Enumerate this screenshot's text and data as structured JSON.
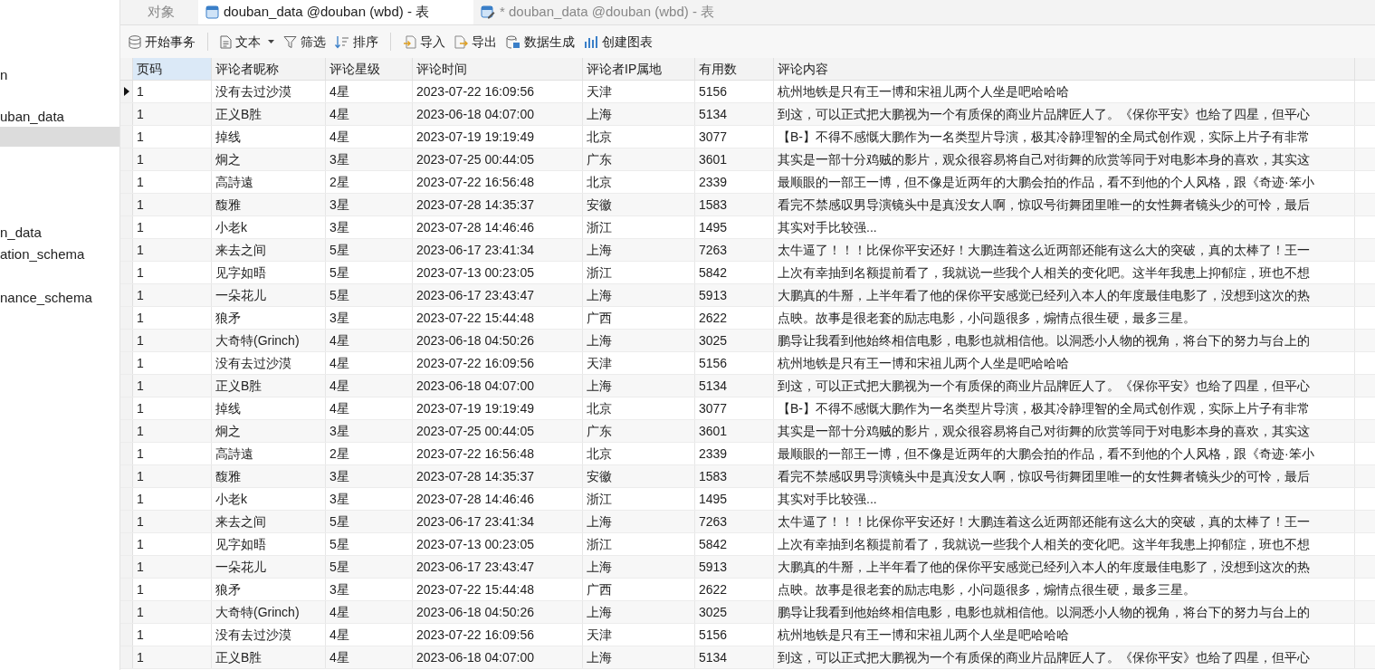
{
  "sidebar": {
    "items": [
      {
        "label": "n",
        "selected": false
      },
      {
        "label": "uban_data",
        "selected": false
      },
      {
        "selected": true
      },
      {
        "label": "n_data",
        "selected": false
      },
      {
        "label": "ation_schema",
        "selected": false
      },
      {
        "label": "nance_schema",
        "selected": false
      }
    ]
  },
  "tabs": [
    {
      "label": "对象",
      "kind": "plain",
      "selected": false
    },
    {
      "label": "douban_data @douban (wbd) - 表",
      "kind": "table",
      "selected": true
    },
    {
      "label": "* douban_data @douban (wbd) - 表",
      "kind": "edit",
      "selected": false
    }
  ],
  "toolbar": [
    {
      "label": "开始事务",
      "kind": "database"
    },
    {
      "label": "文本",
      "kind": "text"
    },
    {
      "label": "筛选",
      "kind": "filter"
    },
    {
      "label": "排序",
      "kind": "sort"
    },
    {
      "label": "导入",
      "kind": "import"
    },
    {
      "label": "导出",
      "kind": "export"
    },
    {
      "label": "数据生成",
      "kind": "generate"
    },
    {
      "label": "创建图表",
      "kind": "chart"
    }
  ],
  "table": {
    "columns": [
      {
        "label": "页码",
        "selected": true
      },
      {
        "label": "评论者昵称",
        "selected": false
      },
      {
        "label": "评论星级",
        "selected": false
      },
      {
        "label": "评论时间",
        "selected": false
      },
      {
        "label": "评论者IP属地",
        "selected": false
      },
      {
        "label": "有用数",
        "selected": false
      },
      {
        "label": "评论内容",
        "selected": false
      }
    ],
    "rows": [
      {
        "selected": true,
        "cells": [
          "1",
          "没有去过沙漠",
          "4星",
          "2023-07-22 16:09:56",
          "天津",
          "5156",
          "杭州地铁是只有王一博和宋祖儿两个人坐是吧哈哈哈"
        ]
      },
      {
        "selected": false,
        "cells": [
          "1",
          "正义B胜",
          "4星",
          "2023-06-18 04:07:00",
          "上海",
          "5134",
          "到这，可以正式把大鹏视为一个有质保的商业片品牌匠人了。《保你平安》也给了四星，但平心"
        ]
      },
      {
        "selected": false,
        "cells": [
          "1",
          "掉线",
          "4星",
          "2023-07-19 19:19:49",
          "北京",
          "3077",
          "【B-】不得不感慨大鹏作为一名类型片导演，极其冷静理智的全局式创作观，实际上片子有非常"
        ]
      },
      {
        "selected": false,
        "cells": [
          "1",
          "炯之",
          "3星",
          "2023-07-25 00:44:05",
          "广东",
          "3601",
          "其实是一部十分鸡贼的影片，观众很容易将自己对街舞的欣赏等同于对电影本身的喜欢，其实这"
        ]
      },
      {
        "selected": false,
        "cells": [
          "1",
          "高詩遠",
          "2星",
          "2023-07-22 16:56:48",
          "北京",
          "2339",
          "最顺眼的一部王一博，但不像是近两年的大鹏会拍的作品，看不到他的个人风格，跟《奇迹·笨小"
        ]
      },
      {
        "selected": false,
        "cells": [
          "1",
          "馥雅",
          "3星",
          "2023-07-28 14:35:37",
          "安徽",
          "1583",
          "看完不禁感叹男导演镜头中是真没女人啊，惊叹号街舞团里唯一的女性舞者镜头少的可怜，最后"
        ]
      },
      {
        "selected": false,
        "cells": [
          "1",
          "小老k",
          "3星",
          "2023-07-28 14:46:46",
          "浙江",
          "1495",
          "其实对手比较强..."
        ]
      },
      {
        "selected": false,
        "cells": [
          "1",
          "来去之间",
          "5星",
          "2023-06-17 23:41:34",
          "上海",
          "7263",
          "太牛逼了！！！比保你平安还好！大鹏连着这么近两部还能有这么大的突破，真的太棒了！王一"
        ]
      },
      {
        "selected": false,
        "cells": [
          "1",
          "见字如晤",
          "5星",
          "2023-07-13 00:23:05",
          "浙江",
          "5842",
          "上次有幸抽到名额提前看了，我就说一些我个人相关的变化吧。这半年我患上抑郁症，班也不想"
        ]
      },
      {
        "selected": false,
        "cells": [
          "1",
          "一朵花儿",
          "5星",
          "2023-06-17 23:43:47",
          "上海",
          "5913",
          "大鹏真的牛掰，上半年看了他的保你平安感觉已经列入本人的年度最佳电影了，没想到这次的热"
        ]
      },
      {
        "selected": false,
        "cells": [
          "1",
          "狼矛",
          "3星",
          "2023-07-22 15:44:48",
          "广西",
          "2622",
          "点映。故事是很老套的励志电影，小问题很多，煽情点很生硬，最多三星。"
        ]
      },
      {
        "selected": false,
        "cells": [
          "1",
          "大奇特(Grinch)",
          "4星",
          "2023-06-18 04:50:26",
          "上海",
          "3025",
          "鹏导让我看到他始终相信电影，电影也就相信他。以洞悉小人物的视角，将台下的努力与台上的"
        ]
      },
      {
        "selected": false,
        "cells": [
          "1",
          "没有去过沙漠",
          "4星",
          "2023-07-22 16:09:56",
          "天津",
          "5156",
          "杭州地铁是只有王一博和宋祖儿两个人坐是吧哈哈哈"
        ]
      },
      {
        "selected": false,
        "cells": [
          "1",
          "正义B胜",
          "4星",
          "2023-06-18 04:07:00",
          "上海",
          "5134",
          "到这，可以正式把大鹏视为一个有质保的商业片品牌匠人了。《保你平安》也给了四星，但平心"
        ]
      },
      {
        "selected": false,
        "cells": [
          "1",
          "掉线",
          "4星",
          "2023-07-19 19:19:49",
          "北京",
          "3077",
          "【B-】不得不感慨大鹏作为一名类型片导演，极其冷静理智的全局式创作观，实际上片子有非常"
        ]
      },
      {
        "selected": false,
        "cells": [
          "1",
          "炯之",
          "3星",
          "2023-07-25 00:44:05",
          "广东",
          "3601",
          "其实是一部十分鸡贼的影片，观众很容易将自己对街舞的欣赏等同于对电影本身的喜欢，其实这"
        ]
      },
      {
        "selected": false,
        "cells": [
          "1",
          "高詩遠",
          "2星",
          "2023-07-22 16:56:48",
          "北京",
          "2339",
          "最顺眼的一部王一博，但不像是近两年的大鹏会拍的作品，看不到他的个人风格，跟《奇迹·笨小"
        ]
      },
      {
        "selected": false,
        "cells": [
          "1",
          "馥雅",
          "3星",
          "2023-07-28 14:35:37",
          "安徽",
          "1583",
          "看完不禁感叹男导演镜头中是真没女人啊，惊叹号街舞团里唯一的女性舞者镜头少的可怜，最后"
        ]
      },
      {
        "selected": false,
        "cells": [
          "1",
          "小老k",
          "3星",
          "2023-07-28 14:46:46",
          "浙江",
          "1495",
          "其实对手比较强..."
        ]
      },
      {
        "selected": false,
        "cells": [
          "1",
          "来去之间",
          "5星",
          "2023-06-17 23:41:34",
          "上海",
          "7263",
          "太牛逼了！！！比保你平安还好！大鹏连着这么近两部还能有这么大的突破，真的太棒了！王一"
        ]
      },
      {
        "selected": false,
        "cells": [
          "1",
          "见字如晤",
          "5星",
          "2023-07-13 00:23:05",
          "浙江",
          "5842",
          "上次有幸抽到名额提前看了，我就说一些我个人相关的变化吧。这半年我患上抑郁症，班也不想"
        ]
      },
      {
        "selected": false,
        "cells": [
          "1",
          "一朵花儿",
          "5星",
          "2023-06-17 23:43:47",
          "上海",
          "5913",
          "大鹏真的牛掰，上半年看了他的保你平安感觉已经列入本人的年度最佳电影了，没想到这次的热"
        ]
      },
      {
        "selected": false,
        "cells": [
          "1",
          "狼矛",
          "3星",
          "2023-07-22 15:44:48",
          "广西",
          "2622",
          "点映。故事是很老套的励志电影，小问题很多，煽情点很生硬，最多三星。"
        ]
      },
      {
        "selected": false,
        "cells": [
          "1",
          "大奇特(Grinch)",
          "4星",
          "2023-06-18 04:50:26",
          "上海",
          "3025",
          "鹏导让我看到他始终相信电影，电影也就相信他。以洞悉小人物的视角，将台下的努力与台上的"
        ]
      },
      {
        "selected": false,
        "cells": [
          "1",
          "没有去过沙漠",
          "4星",
          "2023-07-22 16:09:56",
          "天津",
          "5156",
          "杭州地铁是只有王一博和宋祖儿两个人坐是吧哈哈哈"
        ]
      },
      {
        "selected": false,
        "cells": [
          "1",
          "正义B胜",
          "4星",
          "2023-06-18 04:07:00",
          "上海",
          "5134",
          "到这，可以正式把大鹏视为一个有质保的商业片品牌匠人了。《保你平安》也给了四星，但平心"
        ]
      }
    ]
  }
}
